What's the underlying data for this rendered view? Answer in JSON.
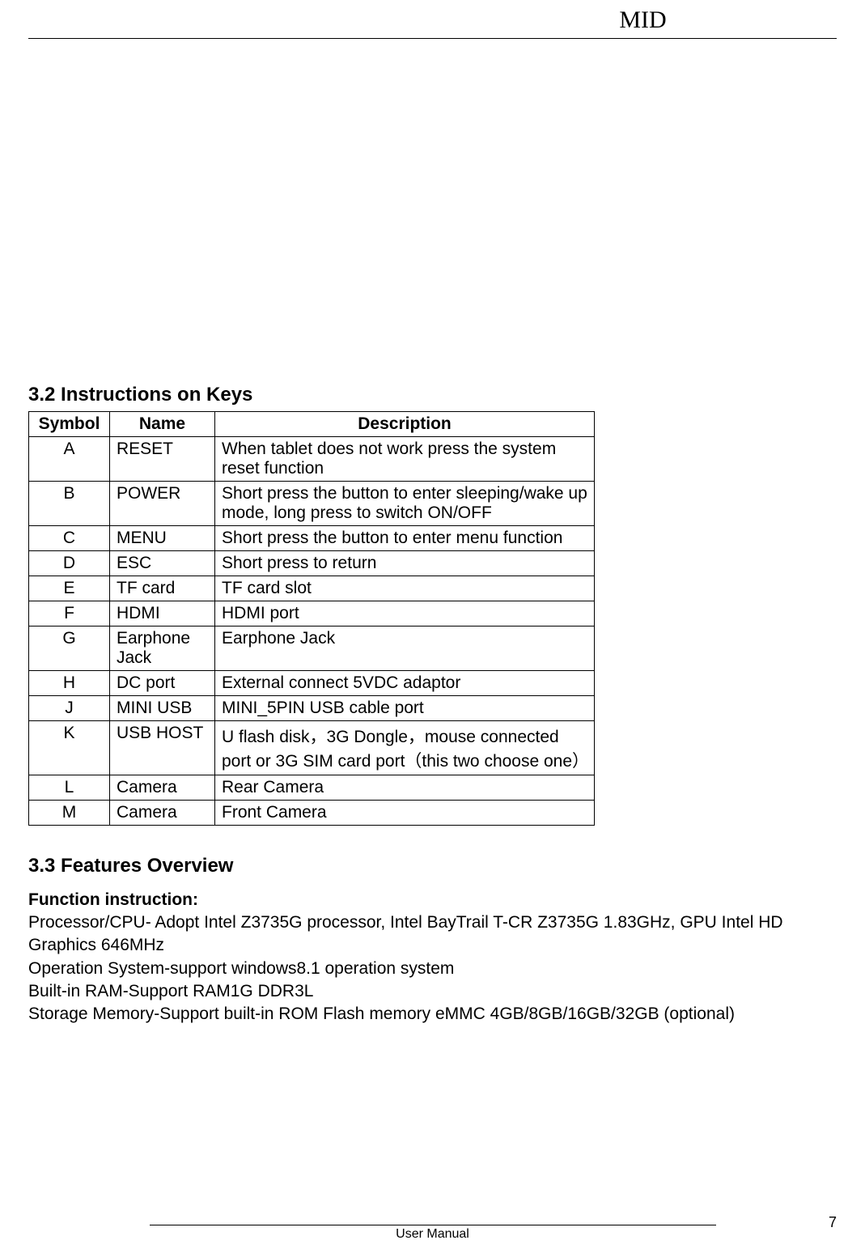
{
  "header": {
    "title": "MID"
  },
  "sections": {
    "s32_heading": "3.2 Instructions on Keys",
    "s33_heading": "3.3 Features Overview"
  },
  "table": {
    "headers": {
      "symbol": "Symbol",
      "name": "Name",
      "description": "Description"
    },
    "rows": [
      {
        "symbol": "A",
        "name": "RESET",
        "description": "When tablet does not work press the system reset function"
      },
      {
        "symbol": "B",
        "name": "POWER",
        "description": "Short press the button to enter sleeping/wake up mode, long press to switch ON/OFF"
      },
      {
        "symbol": "C",
        "name": "MENU",
        "description": "Short press the button to enter menu function"
      },
      {
        "symbol": "D",
        "name": "ESC",
        "description": "Short press to return"
      },
      {
        "symbol": "E",
        "name": "TF card",
        "description": "TF card slot"
      },
      {
        "symbol": "F",
        "name": "HDMI",
        "description": "HDMI port"
      },
      {
        "symbol": "G",
        "name": "Earphone Jack",
        "description": "Earphone Jack"
      },
      {
        "symbol": "H",
        "name": "DC port",
        "description": "External connect 5VDC adaptor"
      },
      {
        "symbol": "J",
        "name": "MINI USB",
        "description": "MINI_5PIN USB cable port"
      },
      {
        "symbol": "K",
        "name": "USB HOST",
        "description": "U flash disk，3G Dongle，mouse connected port or 3G SIM card port（this two choose one）"
      },
      {
        "symbol": "L",
        "name": "Camera",
        "description": "Rear Camera"
      },
      {
        "symbol": "M",
        "name": "Camera",
        "description": "Front Camera"
      }
    ]
  },
  "features": {
    "subheading": "Function instruction:",
    "lines": [
      "Processor/CPU- Adopt Intel Z3735G processor, Intel BayTrail T-CR Z3735G  1.83GHz, GPU Intel HD Graphics  646MHz",
      "Operation System-support windows8.1 operation system",
      "Built-in RAM-Support RAM1G DDR3L",
      "Storage Memory-Support built-in ROM Flash memory eMMC 4GB/8GB/16GB/32GB (optional)"
    ]
  },
  "footer": {
    "center": "User Manual",
    "page": "7"
  }
}
